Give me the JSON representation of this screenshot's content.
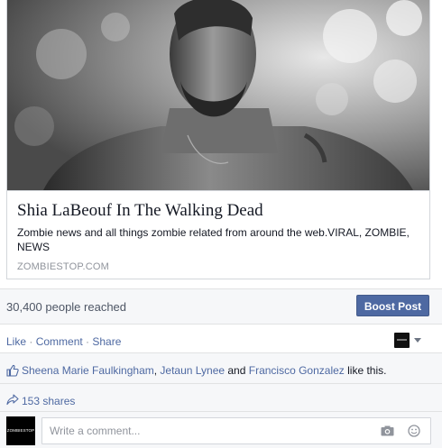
{
  "link_card": {
    "title": "Shia LaBeouf In The Walking Dead",
    "description": "Zombie news and all things zombie related from around the web.VIRAL, ZOMBIE, NEWS",
    "domain": "ZOMBIESTOP.COM"
  },
  "insights": {
    "reach_text": "30,400 people reached",
    "boost_label": "Boost Post"
  },
  "actions": {
    "like": "Like",
    "comment": "Comment",
    "share": "Share",
    "separator": " · "
  },
  "likes": {
    "names": [
      "Sheena Marie Faulkingham",
      "Jetaun Lynee",
      "Francisco Gonzalez"
    ],
    "sep1": ", ",
    "and": " and ",
    "suffix": " like this."
  },
  "shares": {
    "text": "153 shares"
  },
  "comment": {
    "placeholder": "Write a comment...",
    "avatar_text": "ZOMBIESTOP"
  },
  "icons": {
    "thumbs_up": "thumbs-up-icon",
    "share": "share-arrow-icon",
    "camera": "camera-icon",
    "emoji": "emoji-icon"
  },
  "colors": {
    "link_blue": "#4e69a2",
    "boost_bg": "#4e69a2",
    "section_bg": "#f6f7f9"
  }
}
